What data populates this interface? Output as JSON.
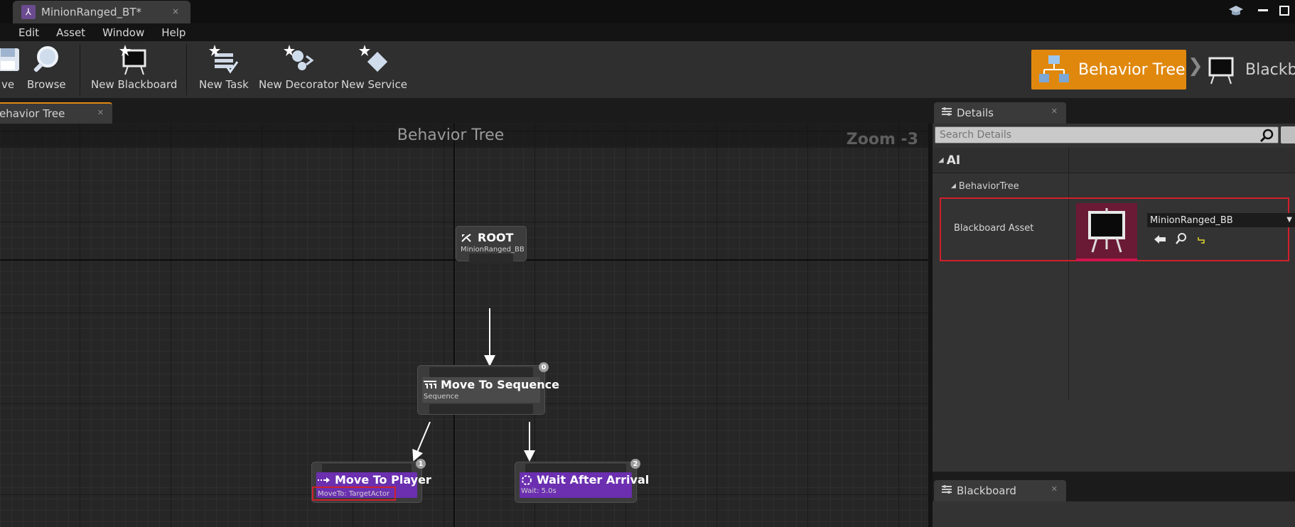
{
  "titlebar": {
    "doc_tab_title": "MinionRanged_BT*",
    "doc_tab_close": "×"
  },
  "menu": [
    "Edit",
    "Asset",
    "Window",
    "Help"
  ],
  "toolbar": {
    "save_label": "ve",
    "browse_label": "Browse",
    "new_blackboard_label": "New Blackboard",
    "new_task_label": "New Task",
    "new_decorator_label": "New Decorator",
    "new_service_label": "New Service"
  },
  "modes": {
    "behavior_tree": "Behavior Tree",
    "blackboard": "Blackbo"
  },
  "graph": {
    "tab_title": "ehavior Tree",
    "header_title": "Behavior Tree",
    "zoom": "Zoom -3",
    "nodes": {
      "root": {
        "title": "ROOT",
        "subtitle": "MinionRanged_BB"
      },
      "sequence": {
        "title": "Move To Sequence",
        "subtitle": "Sequence",
        "index": "0"
      },
      "move_to_player": {
        "title": "Move To Player",
        "subtitle": "MoveTo: TargetActor",
        "index": "1"
      },
      "wait": {
        "title": "Wait After Arrival",
        "subtitle": "Wait: 5.0s",
        "index": "2"
      }
    }
  },
  "details": {
    "tab_title": "Details",
    "search_placeholder": "Search Details",
    "category_ai": "AI",
    "category_behavior_tree": "BehaviorTree",
    "property_label": "Blackboard Asset",
    "property_value": "MinionRanged_BB"
  },
  "blackboard_panel": {
    "tab_title": "Blackboard"
  },
  "colors": {
    "accent_orange": "#e0880e",
    "task_purple": "#6b2fb0",
    "highlight_red": "#d0202c"
  }
}
